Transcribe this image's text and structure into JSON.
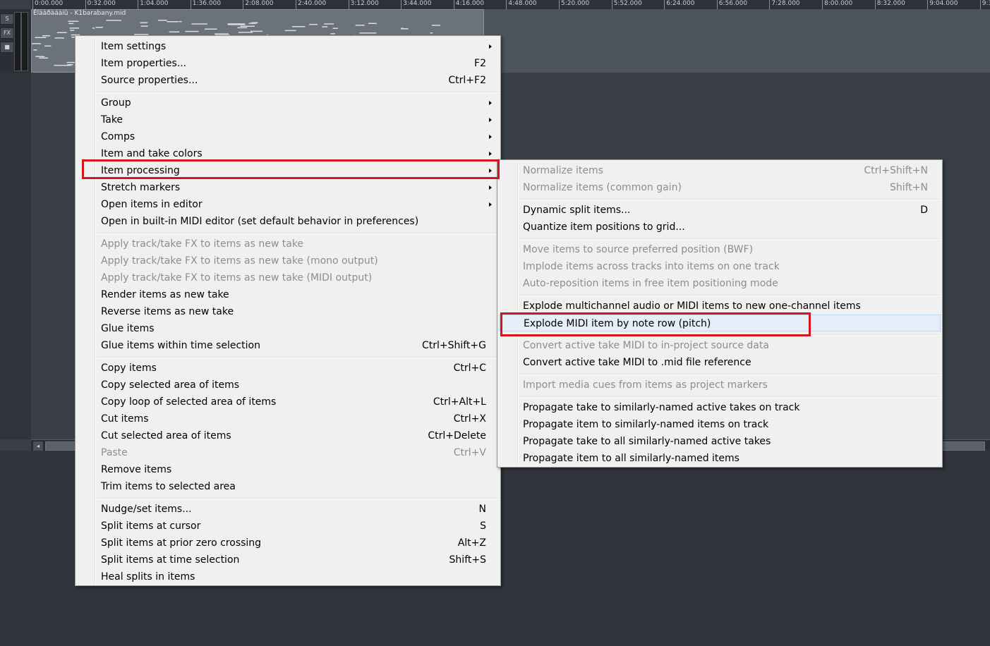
{
  "ruler": {
    "ticks": [
      "0:00.000",
      "0:32.000",
      "1:04.000",
      "1:36.000",
      "2:08.000",
      "2:40.000",
      "3:12.000",
      "3:44.000",
      "4:16.000",
      "4:48.000",
      "5:20.000",
      "5:52.000",
      "6:24.000",
      "6:56.000",
      "7:28.000",
      "8:00.000",
      "8:32.000",
      "9:04.000",
      "9:3"
    ]
  },
  "track": {
    "buttons": [
      "S",
      "FX",
      "■"
    ],
    "item_title": "Êîäàðàáàíû - K1barabany.mid"
  },
  "scrollbar": {
    "left_arrow": "◂"
  },
  "main_menu": {
    "items": [
      {
        "label": "Item settings",
        "shortcut": "",
        "submenu": true,
        "disabled": false
      },
      {
        "label": "Item properties...",
        "shortcut": "F2",
        "submenu": false,
        "disabled": false
      },
      {
        "label": "Source properties...",
        "shortcut": "Ctrl+F2",
        "submenu": false,
        "disabled": false
      },
      {
        "label": "Group",
        "shortcut": "",
        "submenu": true,
        "disabled": false
      },
      {
        "label": "Take",
        "shortcut": "",
        "submenu": true,
        "disabled": false
      },
      {
        "label": "Comps",
        "shortcut": "",
        "submenu": true,
        "disabled": false
      },
      {
        "label": "Item and take colors",
        "shortcut": "",
        "submenu": true,
        "disabled": false
      },
      {
        "label": "Item processing",
        "shortcut": "",
        "submenu": true,
        "disabled": false
      },
      {
        "label": "Stretch markers",
        "shortcut": "",
        "submenu": true,
        "disabled": false
      },
      {
        "label": "Open items in editor",
        "shortcut": "",
        "submenu": true,
        "disabled": false
      },
      {
        "label": "Open in built-in MIDI editor (set default behavior in preferences)",
        "shortcut": "",
        "submenu": false,
        "disabled": false
      },
      {
        "label": "Apply track/take FX to items as new take",
        "shortcut": "",
        "submenu": false,
        "disabled": true
      },
      {
        "label": "Apply track/take FX to items as new take (mono output)",
        "shortcut": "",
        "submenu": false,
        "disabled": true
      },
      {
        "label": "Apply track/take FX to items as new take (MIDI output)",
        "shortcut": "",
        "submenu": false,
        "disabled": true
      },
      {
        "label": "Render items as new take",
        "shortcut": "",
        "submenu": false,
        "disabled": false
      },
      {
        "label": "Reverse items as new take",
        "shortcut": "",
        "submenu": false,
        "disabled": false
      },
      {
        "label": "Glue items",
        "shortcut": "",
        "submenu": false,
        "disabled": false
      },
      {
        "label": "Glue items within time selection",
        "shortcut": "Ctrl+Shift+G",
        "submenu": false,
        "disabled": false
      },
      {
        "label": "Copy items",
        "shortcut": "Ctrl+C",
        "submenu": false,
        "disabled": false
      },
      {
        "label": "Copy selected area of items",
        "shortcut": "",
        "submenu": false,
        "disabled": false
      },
      {
        "label": "Copy loop of selected area of items",
        "shortcut": "Ctrl+Alt+L",
        "submenu": false,
        "disabled": false
      },
      {
        "label": "Cut items",
        "shortcut": "Ctrl+X",
        "submenu": false,
        "disabled": false
      },
      {
        "label": "Cut selected area of items",
        "shortcut": "Ctrl+Delete",
        "submenu": false,
        "disabled": false
      },
      {
        "label": "Paste",
        "shortcut": "Ctrl+V",
        "submenu": false,
        "disabled": true
      },
      {
        "label": "Remove items",
        "shortcut": "",
        "submenu": false,
        "disabled": false
      },
      {
        "label": "Trim items to selected area",
        "shortcut": "",
        "submenu": false,
        "disabled": false
      },
      {
        "label": "Nudge/set items...",
        "shortcut": "N",
        "submenu": false,
        "disabled": false
      },
      {
        "label": "Split items at cursor",
        "shortcut": "S",
        "submenu": false,
        "disabled": false
      },
      {
        "label": "Split items at prior zero crossing",
        "shortcut": "Alt+Z",
        "submenu": false,
        "disabled": false
      },
      {
        "label": "Split items at time selection",
        "shortcut": "Shift+S",
        "submenu": false,
        "disabled": false
      },
      {
        "label": "Heal splits in items",
        "shortcut": "",
        "submenu": false,
        "disabled": false
      }
    ]
  },
  "sub_menu": {
    "items": [
      {
        "label": "Normalize items",
        "shortcut": "Ctrl+Shift+N",
        "disabled": true
      },
      {
        "label": "Normalize items (common gain)",
        "shortcut": "Shift+N",
        "disabled": true
      },
      {
        "label": "Dynamic split items...",
        "shortcut": "D",
        "disabled": false
      },
      {
        "label": "Quantize item positions to grid...",
        "shortcut": "",
        "disabled": false
      },
      {
        "label": "Move items to source preferred position (BWF)",
        "shortcut": "",
        "disabled": true
      },
      {
        "label": "Implode items across tracks into items on one track",
        "shortcut": "",
        "disabled": true
      },
      {
        "label": "Auto-reposition items in free item positioning mode",
        "shortcut": "",
        "disabled": true
      },
      {
        "label": "Explode multichannel audio or MIDI items to new one-channel items",
        "shortcut": "",
        "disabled": false
      },
      {
        "label": "Explode MIDI item by note row (pitch)",
        "shortcut": "",
        "disabled": false
      },
      {
        "label": "Convert active take MIDI to in-project source data",
        "shortcut": "",
        "disabled": true
      },
      {
        "label": "Convert active take MIDI to .mid file reference",
        "shortcut": "",
        "disabled": false
      },
      {
        "label": "Import media cues from items as project markers",
        "shortcut": "",
        "disabled": true
      },
      {
        "label": "Propagate take to similarly-named active takes on track",
        "shortcut": "",
        "disabled": false
      },
      {
        "label": "Propagate item to similarly-named items on track",
        "shortcut": "",
        "disabled": false
      },
      {
        "label": "Propagate take to all similarly-named active takes",
        "shortcut": "",
        "disabled": false
      },
      {
        "label": "Propagate item to all similarly-named items",
        "shortcut": "",
        "disabled": false
      }
    ]
  },
  "colors": {
    "highlight": "#d4141c",
    "menu_bg": "#f0f0f0",
    "disabled_text": "#8d8d8d"
  }
}
